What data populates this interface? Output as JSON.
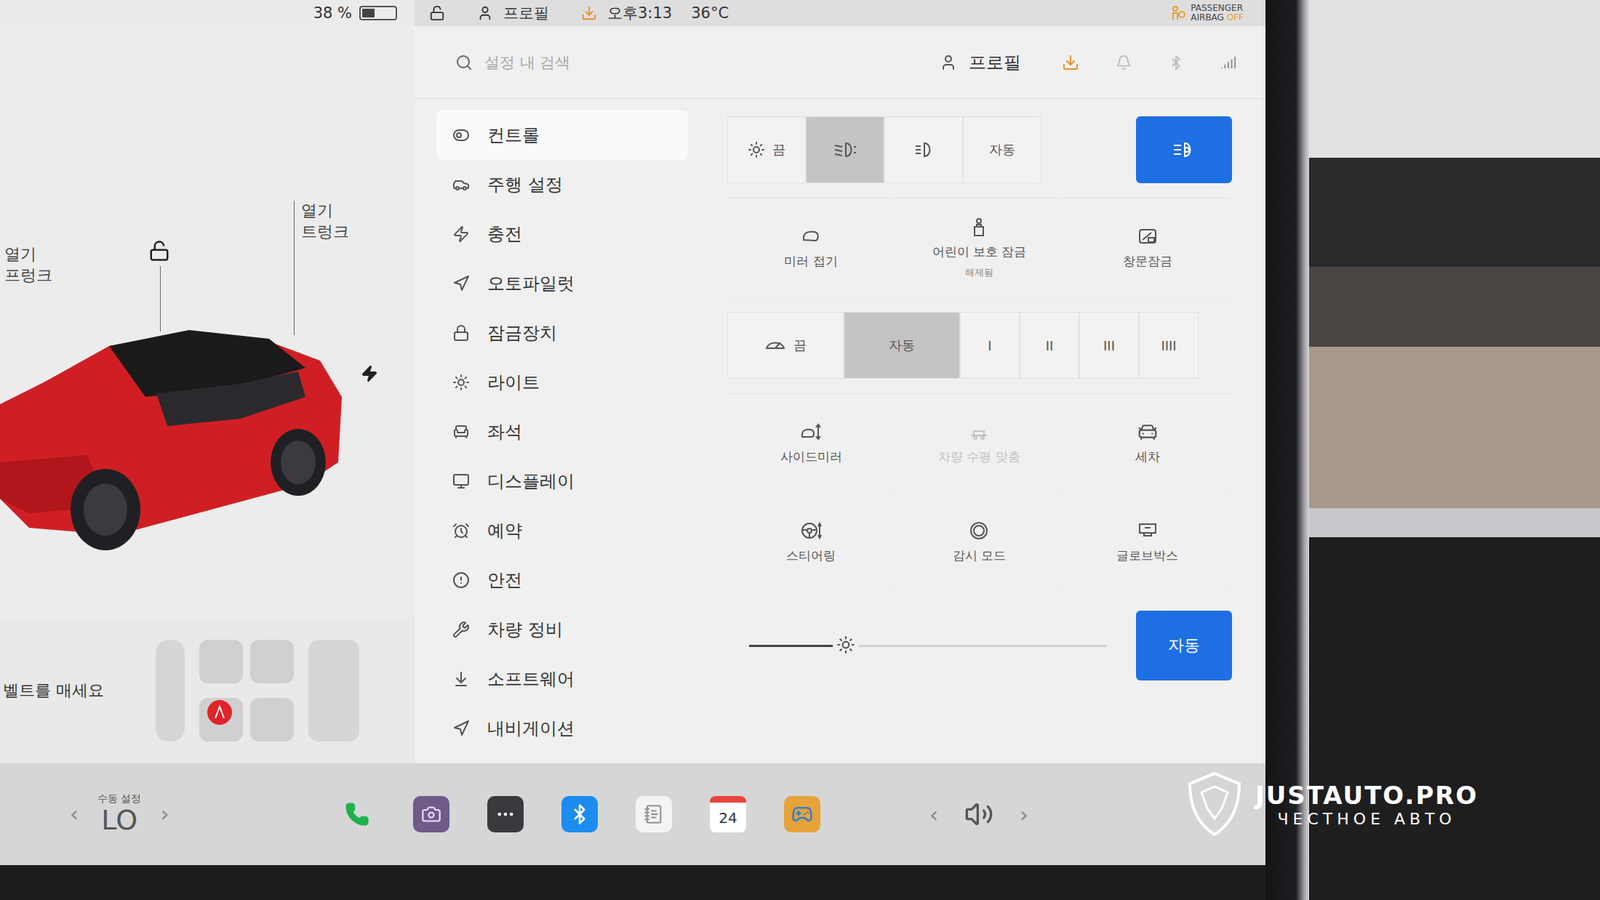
{
  "status_bar": {
    "battery": "38 %",
    "battery_level": 0.38,
    "locked": false,
    "profile": "프로필",
    "time": "오후3:13",
    "temperature": "36°C",
    "airbag": {
      "line1": "PASSENGER",
      "line2": "AIRBAG",
      "state": "OFF"
    }
  },
  "car": {
    "frunk": {
      "action": "열기",
      "label": "프렁크"
    },
    "trunk": {
      "action": "열기",
      "label": "트렁크"
    },
    "doors_locked": false,
    "charging": true,
    "seatbelt_warning": "벨트를 매세요"
  },
  "header": {
    "search_placeholder": "설정 내 검색",
    "profile": "프로필"
  },
  "sidebar": {
    "items": [
      {
        "label": "컨트롤",
        "selected": true
      },
      {
        "label": "주행 설정",
        "selected": false
      },
      {
        "label": "충전",
        "selected": false
      },
      {
        "label": "오토파일럿",
        "selected": false
      },
      {
        "label": "잠금장치",
        "selected": false
      },
      {
        "label": "라이트",
        "selected": false
      },
      {
        "label": "좌석",
        "selected": false
      },
      {
        "label": "디스플레이",
        "selected": false
      },
      {
        "label": "예약",
        "selected": false
      },
      {
        "label": "안전",
        "selected": false
      },
      {
        "label": "차량 정비",
        "selected": false
      },
      {
        "label": "소프트웨어",
        "selected": false
      },
      {
        "label": "내비게이션",
        "selected": false
      }
    ]
  },
  "headlights": {
    "options": [
      {
        "label": "끔",
        "kind": "off",
        "selected": false
      },
      {
        "kind": "low-beam",
        "selected": true
      },
      {
        "kind": "parking",
        "selected": false
      },
      {
        "label": "자동",
        "kind": "auto",
        "selected": false
      }
    ]
  },
  "auto_high_beam": {
    "on": true
  },
  "tiles_upper": [
    {
      "label": "미러 접기",
      "kind": "mirror-fold",
      "disabled": false
    },
    {
      "label": "어린이 보호 잠금",
      "sublabel": "해제됨",
      "kind": "child-lock",
      "disabled": false
    },
    {
      "label": "창문잠금",
      "kind": "window-lock",
      "disabled": false
    }
  ],
  "wipers": {
    "options": [
      {
        "label": "끔",
        "kind": "off",
        "selected": false
      },
      {
        "label": "자동",
        "kind": "text",
        "selected": true
      },
      {
        "label": "I",
        "kind": "text",
        "selected": false
      },
      {
        "label": "II",
        "kind": "text",
        "selected": false
      },
      {
        "label": "III",
        "kind": "text",
        "selected": false
      },
      {
        "label": "IIII",
        "kind": "text",
        "selected": false
      }
    ]
  },
  "tiles_lower": [
    {
      "label": "사이드미러",
      "kind": "side-mirror",
      "disabled": false
    },
    {
      "label": "차량 수평 맞춤",
      "kind": "level",
      "disabled": true
    },
    {
      "label": "세차",
      "kind": "wash",
      "disabled": false
    },
    {
      "label": "스티어링",
      "kind": "steering",
      "disabled": false
    },
    {
      "label": "감시 모드",
      "kind": "sentry",
      "disabled": false
    },
    {
      "label": "글로브박스",
      "kind": "glovebox",
      "disabled": false
    }
  ],
  "brightness": {
    "level": 0.27,
    "auto": {
      "label": "자동",
      "on": true
    }
  },
  "taskbar": {
    "climate": {
      "caption": "수동 설정",
      "temperature": "LO",
      "prev": "‹",
      "next": "›"
    },
    "calendar_day": "24",
    "volume": {
      "prev": "‹",
      "next": "›"
    }
  },
  "watermark": {
    "title": "JUSTAUTO.PRO",
    "subtitle": "ЧЕСТНОЕ АВТО"
  }
}
